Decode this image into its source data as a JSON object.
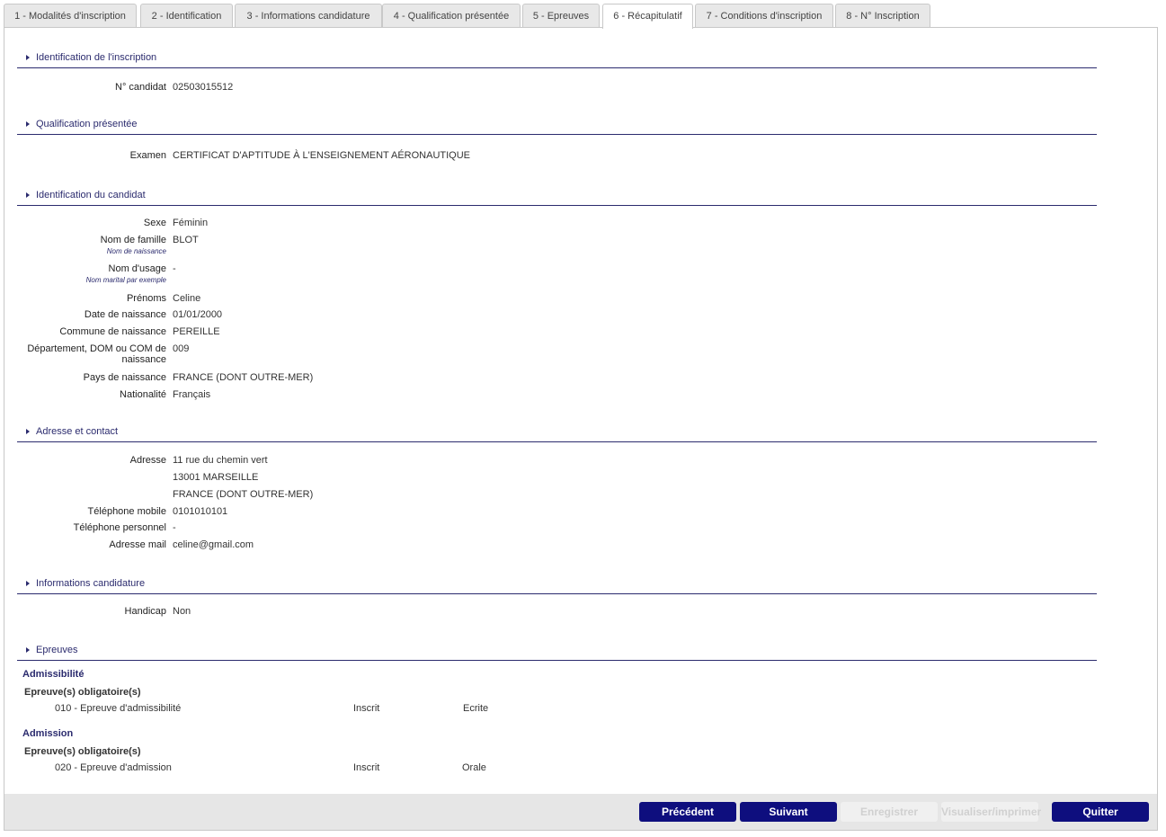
{
  "tabs": [
    "1 - Modalités d'inscription",
    "2 - Identification",
    "3 - Informations candidature",
    "4 - Qualification présentée",
    "5 - Epreuves",
    "6 - Récapitulatif",
    "7 - Conditions d'inscription",
    "8 - N° Inscription"
  ],
  "sections": {
    "inscription": {
      "title": "Identification de l'inscription",
      "candidat_label": "N° candidat",
      "candidat_value": "02503015512"
    },
    "qualification": {
      "title": "Qualification présentée",
      "examen_label": "Examen",
      "examen_value": "CERTIFICAT D'APTITUDE À L'ENSEIGNEMENT AÉRONAUTIQUE"
    },
    "candidat": {
      "title": "Identification du candidat",
      "sexe_label": "Sexe",
      "sexe_value": "Féminin",
      "nom_label": "Nom de famille",
      "nom_sub": "Nom de naissance",
      "nom_value": "BLOT",
      "usage_label": "Nom d'usage",
      "usage_sub": "Nom marital par exemple",
      "usage_value": "-",
      "prenoms_label": "Prénoms",
      "prenoms_value": "Celine",
      "date_label": "Date de naissance",
      "date_value": "01/01/2000",
      "commune_label": "Commune de naissance",
      "commune_value": "PEREILLE",
      "dept_label": "Département, DOM ou COM de naissance",
      "dept_value": "009",
      "pays_label": "Pays de naissance",
      "pays_value": "FRANCE (DONT OUTRE-MER)",
      "nat_label": "Nationalité",
      "nat_value": "Français"
    },
    "adresse": {
      "title": "Adresse et contact",
      "adresse_label": "Adresse",
      "adresse_line1": "11 rue du chemin vert",
      "adresse_line2": "13001 MARSEILLE",
      "adresse_line3": "FRANCE (DONT OUTRE-MER)",
      "mobile_label": "Téléphone mobile",
      "mobile_value": "0101010101",
      "perso_label": "Téléphone personnel",
      "perso_value": "-",
      "mail_label": "Adresse mail",
      "mail_value": "celine@gmail.com"
    },
    "candidature": {
      "title": "Informations candidature",
      "handicap_label": "Handicap",
      "handicap_value": "Non"
    },
    "epreuves": {
      "title": "Epreuves",
      "admissibilite": {
        "heading": "Admissibilité",
        "sub": "Epreuve(s) obligatoire(s)",
        "name": "010 - Epreuve d'admissibilité",
        "status": "Inscrit",
        "type": "Ecrite"
      },
      "admission": {
        "heading": "Admission",
        "sub": "Epreuve(s) obligatoire(s)",
        "name": "020 - Epreuve d'admission",
        "status": "Inscrit",
        "type": "Orale"
      }
    }
  },
  "buttons": {
    "precedent": "Précédent",
    "suivant": "Suivant",
    "enregistrer": "Enregistrer",
    "visualiser": "Visualiser/imprimer",
    "quitter": "Quitter"
  },
  "colors": {
    "accent": "#0e0e7e",
    "section": "#2b2b6e"
  }
}
